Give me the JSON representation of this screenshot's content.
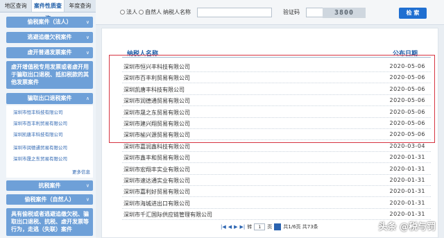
{
  "sidebar": {
    "tabs": [
      "地区查询",
      "案件性质查询",
      "年度查询"
    ],
    "menus": {
      "m1": "偷税案件（法人）",
      "m2": "逃避追缴欠税案件",
      "m3": "虚开普通发票案件",
      "m4": "虚开增值税专用发票或者虚开用于骗取出口退税、抵扣税款的其他发票案件",
      "m5": "骗取出口退税案件",
      "m6": "抗税案件",
      "m7": "偷税案件（自然人）",
      "m8": "具有偷税或者逃避追缴欠税、骗取出口退税、抗税、虚开发票等行为，走逃（失联）案件"
    },
    "sub_items": [
      "深圳市恒丰科技有限公司",
      "深圳市百丰利贸易有限公司",
      "深圳凯唐丰科技有限公司",
      "深圳市润德通贸易有限公司",
      "深圳市晟之东贸易有限公司"
    ],
    "more_label": "更多信息"
  },
  "search": {
    "radio_legal": "法人",
    "radio_person": "自然人",
    "taxpayer_label": "纳税人名称",
    "captcha_label": "验证码",
    "captcha_value": "3800",
    "button": "检 索"
  },
  "table": {
    "col_name": "纳税人名称",
    "col_date": "公布日期",
    "rows": [
      {
        "name": "深圳市恒兴丰科技有限公司",
        "date": "2020-05-06"
      },
      {
        "name": "深圳市百丰利贸易有限公司",
        "date": "2020-05-06"
      },
      {
        "name": "深圳凯唐丰科技有限公司",
        "date": "2020-05-06"
      },
      {
        "name": "深圳市润德通贸易有限公司",
        "date": "2020-05-06"
      },
      {
        "name": "深圳市晟之东贸易有限公司",
        "date": "2020-05-06"
      },
      {
        "name": "深圳市建兴翔贸易有限公司",
        "date": "2020-05-06"
      },
      {
        "name": "深圳市榆兴源贸易有限公司",
        "date": "2020-05-06"
      },
      {
        "name": "深圳市嘉润鑫科技有限公司",
        "date": "2020-03-04"
      },
      {
        "name": "深圳市鑫丰和贸易有限公司",
        "date": "2020-01-31"
      },
      {
        "name": "深圳市宏翔丰实业有限公司",
        "date": "2020-01-31"
      },
      {
        "name": "深圳市速达通实业有限公司",
        "date": "2020-01-31"
      },
      {
        "name": "深圳市嘉利好贸易有限公司",
        "date": "2020-01-31"
      },
      {
        "name": "深圳市海城进出口有限公司",
        "date": "2020-01-31"
      },
      {
        "name": "深圳市千汇国际供应链管理有限公司",
        "date": "2020-01-31"
      }
    ]
  },
  "pager": {
    "goto_label": "转",
    "page_value": "1",
    "page_info": "页",
    "summary": "共1/6页 共73条"
  },
  "watermark": "头条 @税与罚"
}
